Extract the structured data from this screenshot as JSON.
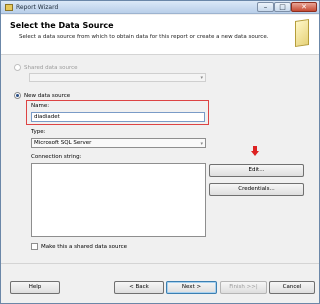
{
  "window": {
    "title": "Report Wizard",
    "controls": {
      "minimize": "–",
      "maximize": "□",
      "close": "✕"
    }
  },
  "header": {
    "title": "Select the Data Source",
    "subtitle": "Select a data source from which to obtain data for this report or create a new data source.",
    "icon": "wizard-page-icon"
  },
  "shared_source": {
    "label": "Shared data source",
    "selected": false,
    "enabled": false,
    "value": ""
  },
  "new_source": {
    "label": "New data source",
    "selected": true,
    "name_label": "Name:",
    "name_value": "diadiadet",
    "type_label": "Type:",
    "type_value": "Microsoft SQL Server",
    "connection_label": "Connection string:",
    "connection_value": ""
  },
  "buttons": {
    "edit": "Edit...",
    "credentials": "Credentials..."
  },
  "make_shared": {
    "label": "Make this a shared data source",
    "checked": false
  },
  "footer": {
    "help": "Help",
    "back": "< Back",
    "next": "Next >",
    "finish": "Finish >>|",
    "cancel": "Cancel"
  },
  "colors": {
    "highlight_box": "#dd4444",
    "arrow": "#dd2222"
  }
}
